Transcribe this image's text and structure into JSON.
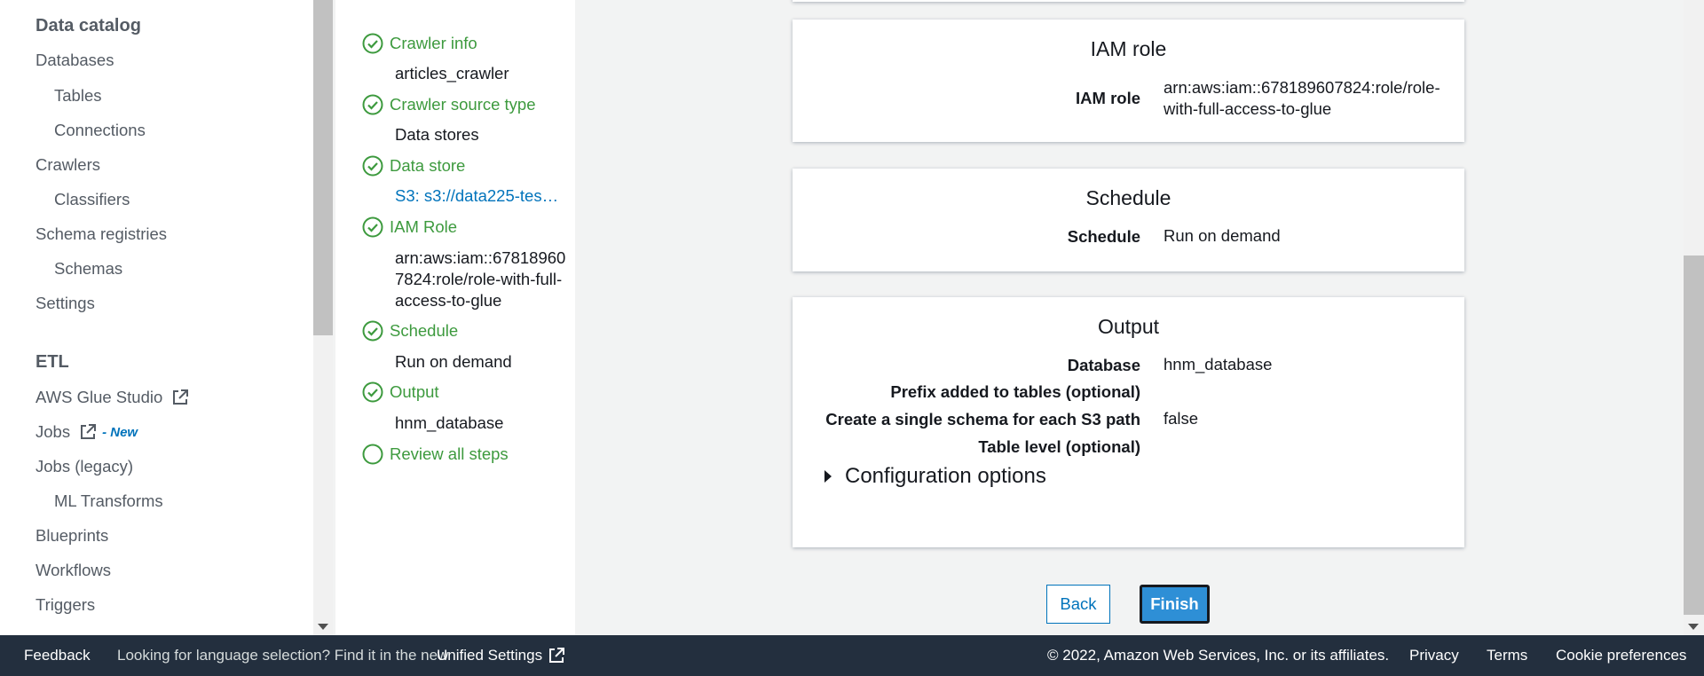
{
  "sidebar": {
    "data_catalog_heading": "Data catalog",
    "items_catalog": [
      {
        "label": "Databases"
      },
      {
        "label": "Tables"
      },
      {
        "label": "Connections"
      },
      {
        "label": "Crawlers"
      },
      {
        "label": "Classifiers"
      },
      {
        "label": "Schema registries"
      },
      {
        "label": "Schemas"
      },
      {
        "label": "Settings"
      }
    ],
    "etl_heading": "ETL",
    "items_etl": [
      {
        "label": "AWS Glue Studio"
      },
      {
        "label": "Jobs",
        "badge": "- New"
      },
      {
        "label": "Jobs (legacy)"
      },
      {
        "label": "ML Transforms"
      },
      {
        "label": "Blueprints"
      },
      {
        "label": "Workflows"
      },
      {
        "label": "Triggers"
      }
    ]
  },
  "steps": [
    {
      "label": "Crawler info",
      "value": "articles_crawler",
      "done": true
    },
    {
      "label": "Crawler source type",
      "value": "Data stores",
      "done": true
    },
    {
      "label": "Data store",
      "value": "S3: s3://data225-tes…",
      "done": true
    },
    {
      "label": "IAM Role",
      "value": "arn:aws:iam::678189607824:role/role-with-full-access-to-glue",
      "done": true
    },
    {
      "label": "Schedule",
      "value": "Run on demand",
      "done": true
    },
    {
      "label": "Output",
      "value": "hnm_database",
      "done": true
    },
    {
      "label": "Review all steps",
      "done": false
    }
  ],
  "iam_card": {
    "title": "IAM role",
    "key": "IAM role",
    "value": "arn:aws:iam::678189607824:role/role-with-full-access-to-glue"
  },
  "schedule_card": {
    "title": "Schedule",
    "key": "Schedule",
    "value": "Run on demand"
  },
  "output_card": {
    "title": "Output",
    "rows": [
      {
        "key": "Database",
        "value": "hnm_database"
      },
      {
        "key": "Prefix added to tables (optional)",
        "value": ""
      },
      {
        "key": "Create a single schema for each S3 path",
        "value": "false"
      },
      {
        "key": "Table level (optional)",
        "value": ""
      }
    ],
    "config_label": "Configuration options"
  },
  "buttons": {
    "back": "Back",
    "finish": "Finish"
  },
  "footer": {
    "feedback": "Feedback",
    "language_text": "Looking for language selection? Find it in the new",
    "unified_settings": "Unified Settings",
    "copyright": "© 2022, Amazon Web Services, Inc. or its affiliates.",
    "privacy": "Privacy",
    "terms": "Terms",
    "cookie": "Cookie preferences"
  },
  "colors": {
    "step_green": "#3d9a3e",
    "link_blue": "#0073bb",
    "finish_blue": "#2e8fd6",
    "footer_bg": "#232f3e"
  }
}
